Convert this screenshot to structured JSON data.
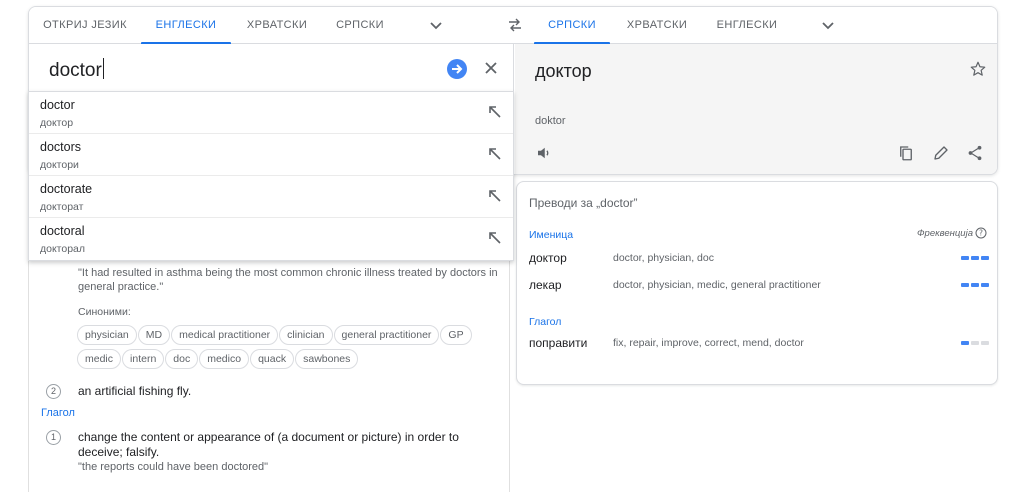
{
  "source_tabs": [
    {
      "label": "ОТКРИЈ ЈЕЗИК",
      "active": false
    },
    {
      "label": "ЕНГЛЕСКИ",
      "active": true
    },
    {
      "label": "ХРВАТСКИ",
      "active": false
    },
    {
      "label": "СРПСКИ",
      "active": false
    }
  ],
  "target_tabs": [
    {
      "label": "СРПСКИ",
      "active": true
    },
    {
      "label": "ХРВАТСКИ",
      "active": false
    },
    {
      "label": "ЕНГЛЕСКИ",
      "active": false
    }
  ],
  "source": {
    "text": "doctor"
  },
  "target": {
    "text": "доктор",
    "transliteration": "doktor"
  },
  "suggestions": [
    {
      "word": "doctor",
      "translation": "доктор"
    },
    {
      "word": "doctors",
      "translation": "доктори"
    },
    {
      "word": "doctorate",
      "translation": "докторат"
    },
    {
      "word": "doctoral",
      "translation": "докторал"
    }
  ],
  "definitions": {
    "example_1": "\"It had resulted in asthma being the most common chronic illness treated by doctors in general practice.\"",
    "synonyms_label": "Синоними:",
    "synonyms": [
      "physician",
      "MD",
      "medical practitioner",
      "clinician",
      "general practitioner",
      "GP",
      "medic",
      "intern",
      "doc",
      "medico",
      "quack",
      "sawbones"
    ],
    "def_2_num": "2",
    "def_2_text": "an artificial fishing fly.",
    "verb_label": "Глагол",
    "def_v1_num": "1",
    "def_v1_text": "change the content or appearance of (a document or picture) in order to deceive; falsify.",
    "def_v1_example": "\"the reports could have been doctored\""
  },
  "translations": {
    "title": "Преводи за „doctor”",
    "frequency_label": "Фреквенција",
    "groups": [
      {
        "pos": "Именица",
        "rows": [
          {
            "word": "доктор",
            "back": "doctor, physician, doc",
            "frequency": 3
          },
          {
            "word": "лекар",
            "back": "doctor, physician, medic, general practitioner",
            "frequency": 3
          }
        ]
      },
      {
        "pos": "Глагол",
        "rows": [
          {
            "word": "поправити",
            "back": "fix, repair, improve, correct, mend, doctor",
            "frequency": 1
          }
        ]
      }
    ]
  },
  "colors": {
    "accent": "#1a73e8",
    "freq_on": "#4285f4",
    "freq_off": "#dadce0"
  }
}
